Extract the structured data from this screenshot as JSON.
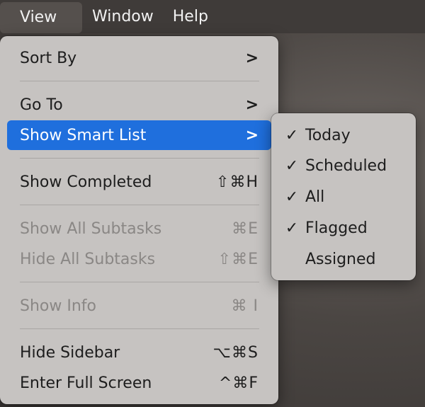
{
  "menubar": {
    "items": [
      {
        "label": "View"
      },
      {
        "label": "Window"
      },
      {
        "label": "Help"
      }
    ]
  },
  "menu": {
    "sort_by": {
      "label": "Sort By",
      "chevron": ">"
    },
    "go_to": {
      "label": "Go To",
      "chevron": ">"
    },
    "show_smart_list": {
      "label": "Show Smart List",
      "chevron": ">"
    },
    "show_completed": {
      "label": "Show Completed",
      "shortcut": "⇧⌘H"
    },
    "show_all_subtasks": {
      "label": "Show All Subtasks",
      "shortcut": "⌘E"
    },
    "hide_all_subtasks": {
      "label": "Hide All Subtasks",
      "shortcut": "⇧⌘E"
    },
    "show_info": {
      "label": "Show Info",
      "shortcut": "⌘ I"
    },
    "hide_sidebar": {
      "label": "Hide Sidebar",
      "shortcut": "⌥⌘S"
    },
    "enter_full_screen": {
      "label": "Enter Full Screen",
      "shortcut": "^⌘F"
    }
  },
  "submenu": {
    "items": [
      {
        "label": "Today",
        "check": "✓"
      },
      {
        "label": "Scheduled",
        "check": "✓"
      },
      {
        "label": "All",
        "check": "✓"
      },
      {
        "label": "Flagged",
        "check": "✓"
      },
      {
        "label": "Assigned",
        "check": ""
      }
    ]
  },
  "colors": {
    "highlight": "#1f6fdd",
    "menu_bg": "#c6c3c1",
    "disabled_text": "#8a8785"
  }
}
